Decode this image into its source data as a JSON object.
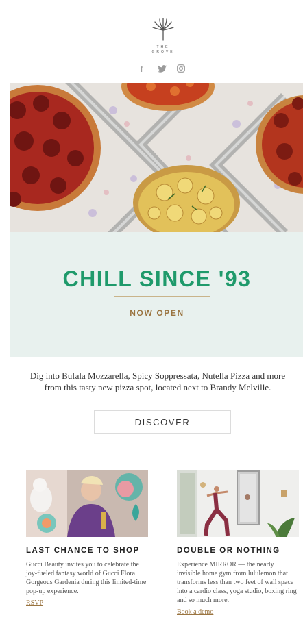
{
  "brand": {
    "logo_text": "THE GROVE"
  },
  "social": {
    "icons": [
      "facebook-icon",
      "twitter-icon",
      "instagram-icon"
    ],
    "facebook_glyph": "f"
  },
  "banner": {
    "title": "CHILL SINCE '93",
    "subtitle": "NOW OPEN",
    "colors": {
      "title": "#1f9a6b",
      "subtitle": "#9a7440",
      "background": "#e8f1ee"
    }
  },
  "intro": {
    "description": "Dig into Bufala Mozzarella, Spicy Soppressata, Nutella Pizza and more from this tasty new pizza spot, located next to Brandy Melville."
  },
  "cta": {
    "label": "DISCOVER"
  },
  "cards": [
    {
      "title": "LAST CHANCE TO SHOP",
      "body": "Gucci Beauty invites you to celebrate the joy-fueled fantasy world of Gucci Flora Gorgeous Gardenia during this limited-time pop-up experience.",
      "link": "RSVP"
    },
    {
      "title": "DOUBLE OR NOTHING",
      "body": "Experience MIRROR — the nearly invisible home gym from lululemon that transforms less than two feet of wall space into a cardio class, yoga studio, boxing ring and so much more.",
      "link": "Book a demo"
    }
  ]
}
